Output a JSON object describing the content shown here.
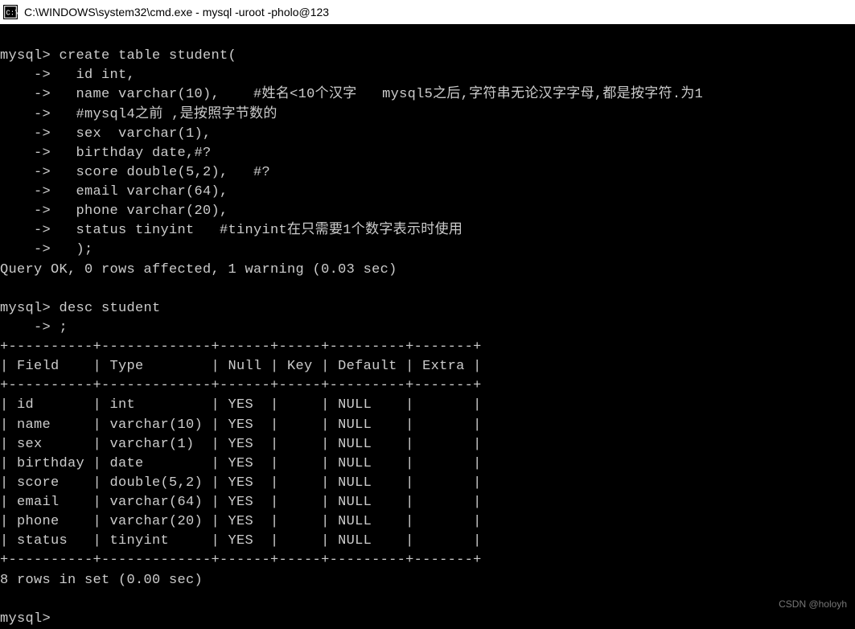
{
  "title": "C:\\WINDOWS\\system32\\cmd.exe - mysql  -uroot -pholo@123",
  "terminal": {
    "prompt1": "mysql>",
    "cont": "    ->",
    "create": {
      "l1": " create table student(",
      "l2": "   id int,",
      "l3": "   name varchar(10),    #姓名<10个汉字   mysql5之后,字符串无论汉字字母,都是按字符.为1",
      "l4": "   #mysql4之前 ,是按照字节数的",
      "l5": "   sex  varchar(1),",
      "l6": "   birthday date,#?",
      "l7": "   score double(5,2),   #?",
      "l8": "   email varchar(64),",
      "l9": "   phone varchar(20),",
      "l10": "   status tinyint   #tinyint在只需要1个数字表示时使用",
      "l11": "   );"
    },
    "result1": "Query OK, 0 rows affected, 1 warning (0.03 sec)",
    "blank": "",
    "desc_cmd": " desc student",
    "desc_end": " ;",
    "table": {
      "border": "+----------+-------------+------+-----+---------+-------+",
      "header": "| Field    | Type        | Null | Key | Default | Extra |",
      "r1": "| id       | int         | YES  |     | NULL    |       |",
      "r2": "| name     | varchar(10) | YES  |     | NULL    |       |",
      "r3": "| sex      | varchar(1)  | YES  |     | NULL    |       |",
      "r4": "| birthday | date        | YES  |     | NULL    |       |",
      "r5": "| score    | double(5,2) | YES  |     | NULL    |       |",
      "r6": "| email    | varchar(64) | YES  |     | NULL    |       |",
      "r7": "| phone    | varchar(20) | YES  |     | NULL    |       |",
      "r8": "| status   | tinyint     | YES  |     | NULL    |       |"
    },
    "result2": "8 rows in set (0.00 sec)",
    "prompt_final": "mysql>"
  },
  "watermark": "CSDN @holoyh"
}
